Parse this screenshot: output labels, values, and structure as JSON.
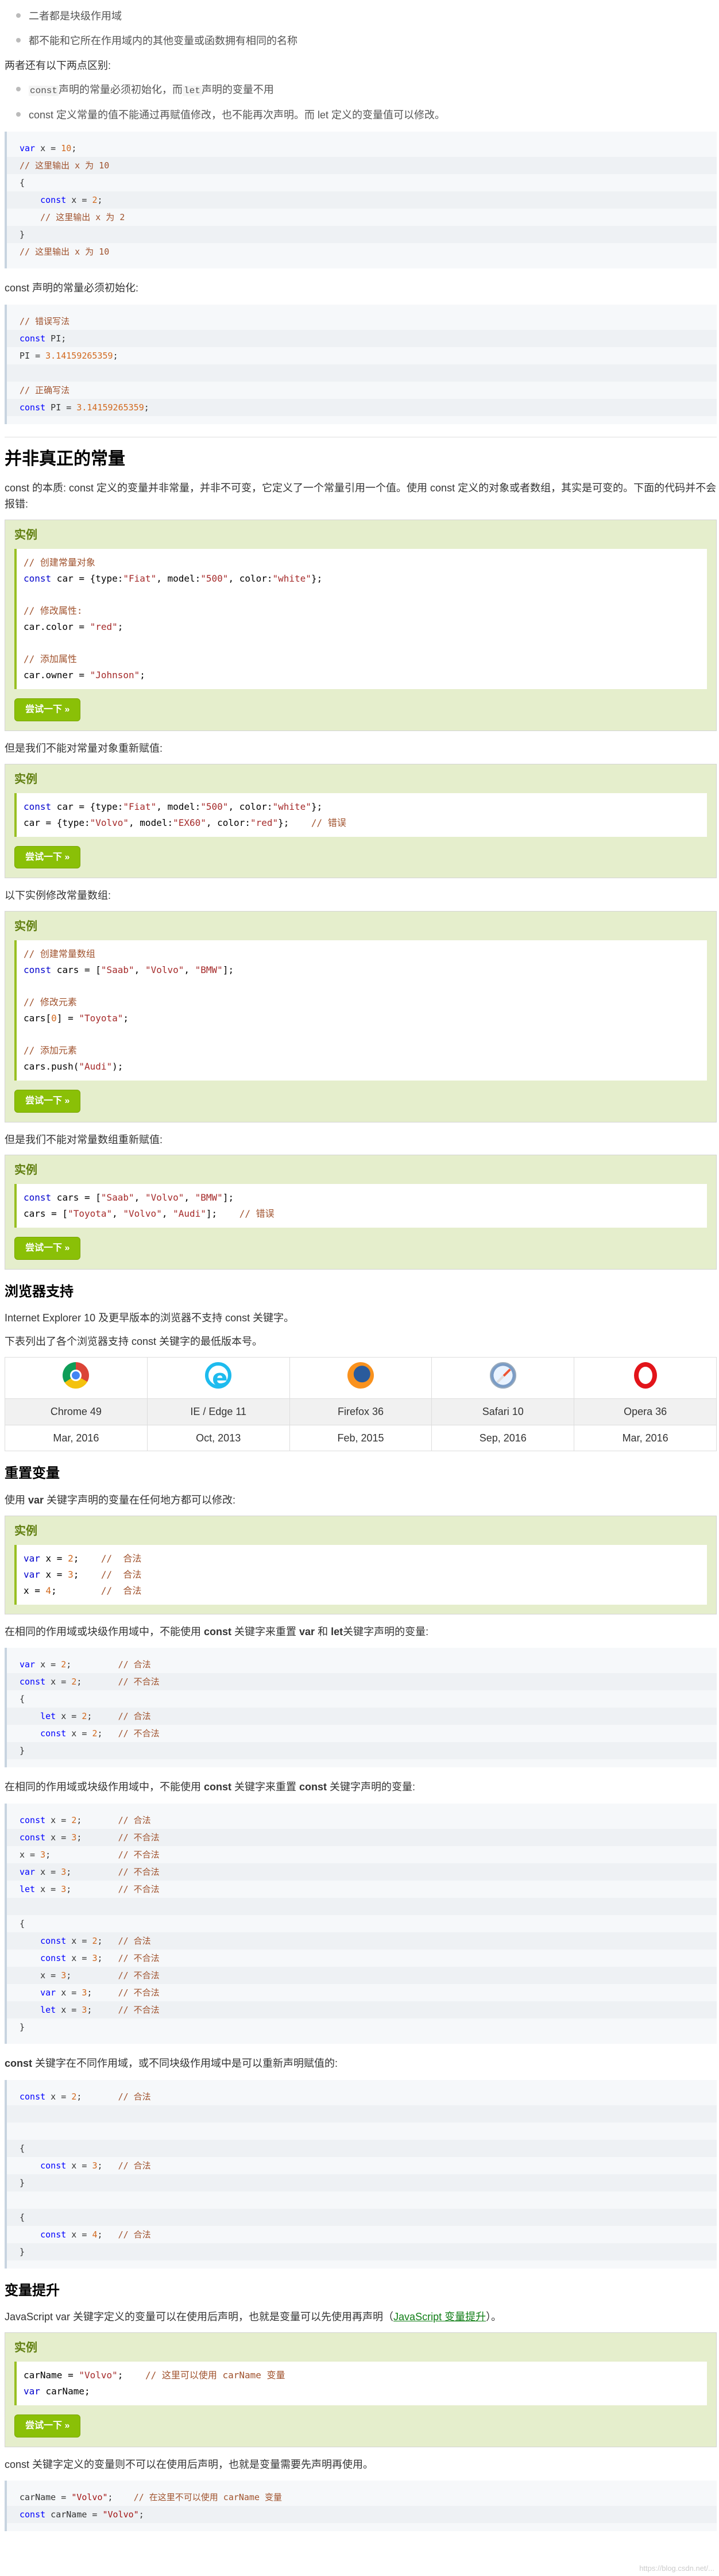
{
  "top_list": [
    "二者都是块级作用域",
    "都不能和它所在作用域内的其他变量或函数拥有相同的名称"
  ],
  "diff_intro": "两者还有以下两点区别:",
  "diff_list": {
    "item1_code1": "const",
    "item1_text1": "声明的常量必须初始化，而",
    "item1_code2": "let",
    "item1_text2": "声明的变量不用",
    "item2": "const 定义常量的值不能通过再赋值修改，也不能再次声明。而 let 定义的变量值可以修改。"
  },
  "const_init_text": "const 声明的常量必须初始化:",
  "section_not_const": {
    "title": "并非真正的常量",
    "desc": "const 的本质: const 定义的变量并非常量，并非不可变，它定义了一个常量引用一个值。使用 const 定义的对象或者数组，其实是可变的。下面的代码并不会报错:"
  },
  "example_label": "实例",
  "try_button": "尝试一下 »",
  "text_cannot_reassign_obj": "但是我们不能对常量对象重新赋值:",
  "text_modify_array": "以下实例修改常量数组:",
  "text_cannot_reassign_arr": "但是我们不能对常量数组重新赋值:",
  "browser_section": {
    "title": "浏览器支持",
    "line1": "Internet Explorer 10 及更早版本的浏览器不支持 const 关键字。",
    "line2": "下表列出了各个浏览器支持 const 关键字的最低版本号。",
    "icons": [
      "chrome-icon",
      "ie-icon",
      "firefox-icon",
      "safari-icon",
      "opera-icon"
    ],
    "names": [
      "Chrome 49",
      "IE / Edge 11",
      "Firefox 36",
      "Safari 10",
      "Opera 36"
    ],
    "dates": [
      "Mar, 2016",
      "Oct, 2013",
      "Feb, 2015",
      "Sep, 2016",
      "Mar, 2016"
    ]
  },
  "redeclare_section": {
    "title": "重置变量",
    "intro_pre": "使用 ",
    "intro_kw": "var",
    "intro_post": " 关键字声明的变量在任何地方都可以修改:",
    "text2_pre": "在相同的作用域或块级作用域中，不能使用 ",
    "text2_kw1": "const",
    "text2_mid": " 关键字来重置 ",
    "text2_kw2": "var",
    "text2_and": " 和 ",
    "text2_kw3": "let",
    "text2_post": "关键字声明的变量:",
    "text3_pre": "在相同的作用域或块级作用域中，不能使用 ",
    "text3_kw1": "const",
    "text3_mid": " 关键字来重置 ",
    "text3_kw2": "const",
    "text3_post": " 关键字声明的变量:",
    "text4_kw": "const",
    "text4_post": " 关键字在不同作用域，或不同块级作用域中是可以重新声明赋值的:"
  },
  "hoisting_section": {
    "title": "变量提升",
    "text_pre": "JavaScript var 关键字定义的变量可以在使用后声明，也就是变量可以先使用再声明（",
    "link": "JavaScript 变量提升",
    "text_post": "）。",
    "after": "const 关键字定义的变量则不可以在使用后声明，也就是变量需要先声明再使用。"
  },
  "watermark": "https://blog.csdn.net/..."
}
